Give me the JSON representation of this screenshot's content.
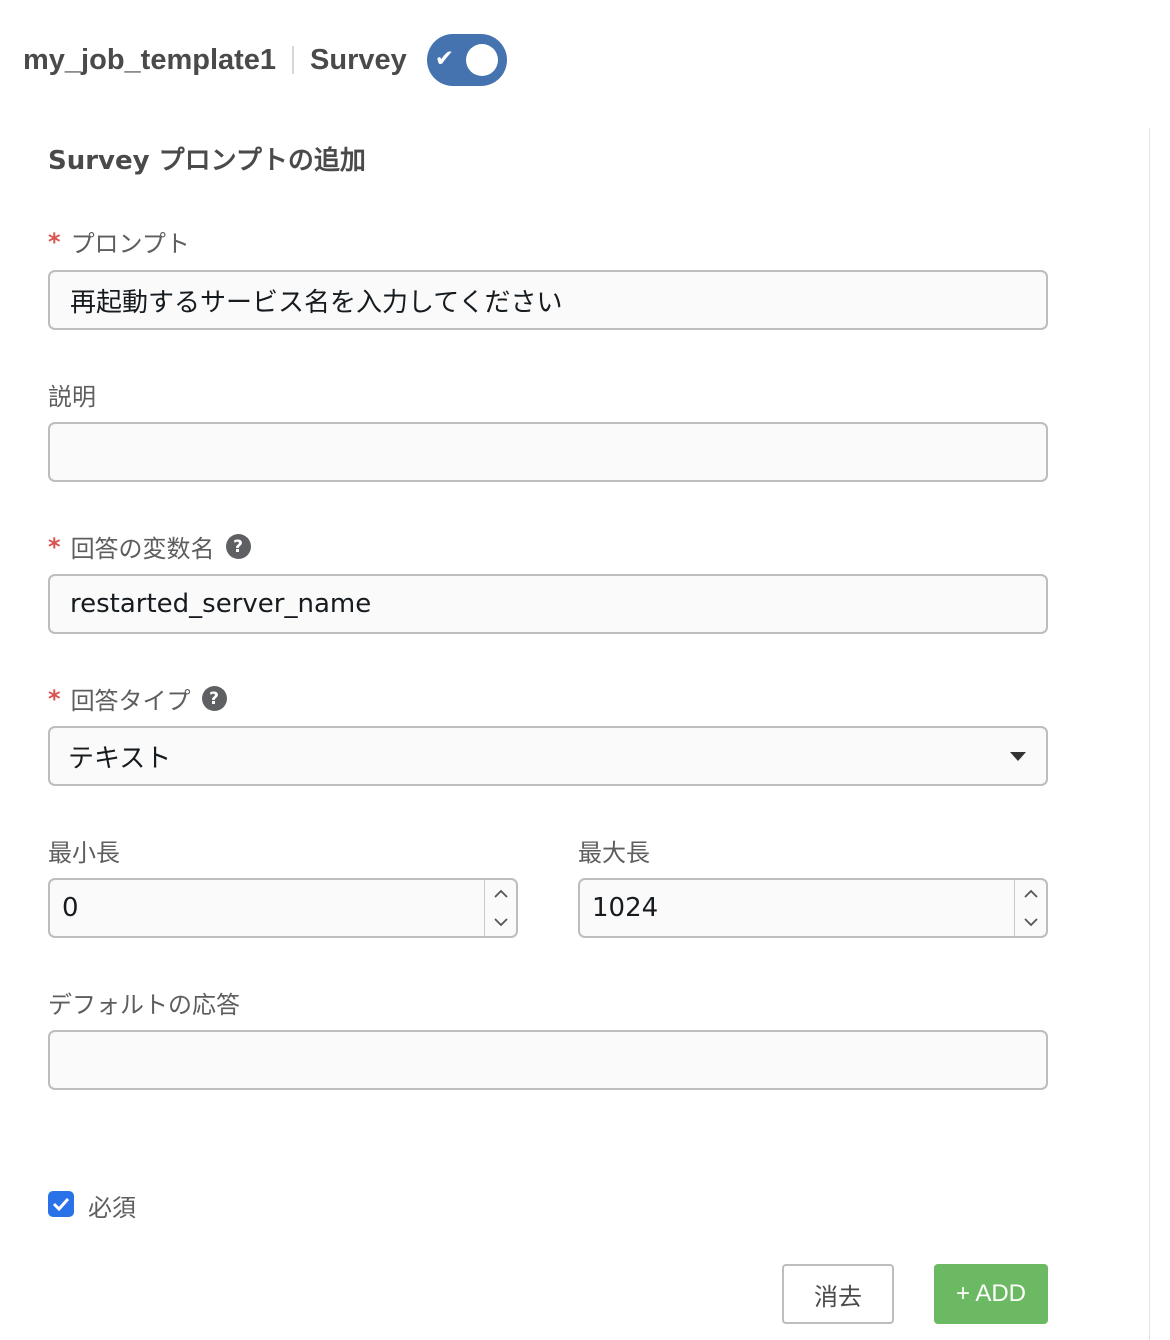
{
  "header": {
    "template_name": "my_job_template1",
    "section": "Survey",
    "survey_enabled": true
  },
  "form": {
    "title": "Survey プロンプトの追加",
    "required_marker": "*",
    "prompt": {
      "label": "プロンプト",
      "value": "再起動するサービス名を入力してください"
    },
    "description": {
      "label": "説明",
      "value": ""
    },
    "variable": {
      "label": "回答の変数名",
      "value": "restarted_server_name",
      "help": "?"
    },
    "answer_type": {
      "label": "回答タイプ",
      "value": "テキスト",
      "help": "?"
    },
    "min_length": {
      "label": "最小長",
      "value": "0"
    },
    "max_length": {
      "label": "最大長",
      "value": "1024"
    },
    "default_answer": {
      "label": "デフォルトの応答",
      "value": ""
    },
    "required": {
      "label": "必須",
      "checked": true
    }
  },
  "buttons": {
    "clear_label": "消去",
    "add_label": "+ ADD"
  },
  "colors": {
    "toggle": "#4573b0",
    "required_star": "#d9534f",
    "checkbox": "#2a72e8",
    "add_button": "#6cb963"
  }
}
